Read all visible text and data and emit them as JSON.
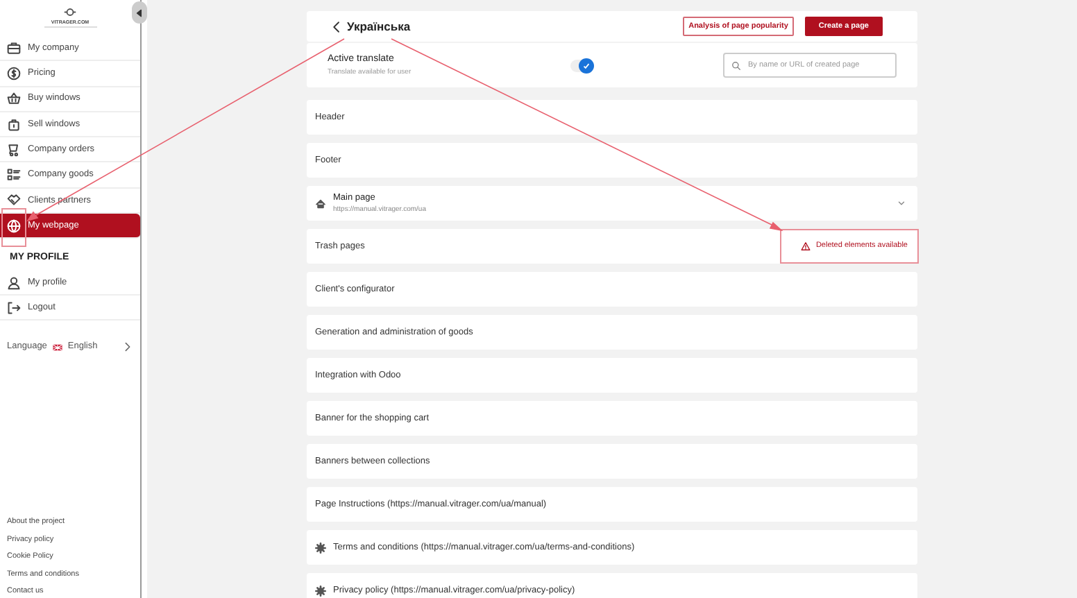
{
  "sidebar": {
    "logo": "VITRAGER.COM",
    "items": [
      {
        "label": "My company",
        "selected": false
      },
      {
        "label": "Pricing",
        "selected": false
      },
      {
        "label": "Buy windows",
        "selected": false
      },
      {
        "label": "Sell windows",
        "selected": false
      },
      {
        "label": "Company orders",
        "selected": false
      },
      {
        "label": "Company goods",
        "selected": false
      },
      {
        "label": "Clients partners",
        "selected": false
      },
      {
        "label": "My webpage",
        "selected": true
      }
    ],
    "profile_heading": "MY PROFILE",
    "profile_items": [
      {
        "label": "My profile"
      },
      {
        "label": "Logout"
      }
    ],
    "language": {
      "label": "Language",
      "value": "English"
    },
    "footer_links": [
      "About the project",
      "Privacy policy",
      "Cookie Policy",
      "Terms and conditions",
      "Contact us"
    ]
  },
  "header": {
    "title": "Українська",
    "analysis_button": "Analysis of page popularity",
    "create_button": "Create a page"
  },
  "translate": {
    "label": "Active translate",
    "hint": "Translate available for user",
    "on": true,
    "search_placeholder": "By name or URL of created page"
  },
  "pages": [
    {
      "kind": "plain",
      "title": "Header"
    },
    {
      "kind": "plain",
      "title": "Footer"
    },
    {
      "kind": "home",
      "title": "Main page",
      "url": "https://manual.vitrager.com/ua"
    },
    {
      "kind": "trash",
      "title": "Trash pages",
      "notice": "Deleted elements available"
    },
    {
      "kind": "plain",
      "title": "Client's configurator"
    },
    {
      "kind": "plain",
      "title": "Generation and administration of goods"
    },
    {
      "kind": "plain",
      "title": "Integration with Odoo"
    },
    {
      "kind": "plain",
      "title": "Banner for the shopping cart"
    },
    {
      "kind": "plain",
      "title": "Banners between collections"
    },
    {
      "kind": "plain",
      "title": "Page Instructions (https://manual.vitrager.com/ua/manual)"
    },
    {
      "kind": "settings",
      "title": "Terms and conditions (https://manual.vitrager.com/ua/terms-and-conditions)"
    },
    {
      "kind": "settings",
      "title": "Privacy policy (https://manual.vitrager.com/ua/privacy-policy)"
    }
  ]
}
